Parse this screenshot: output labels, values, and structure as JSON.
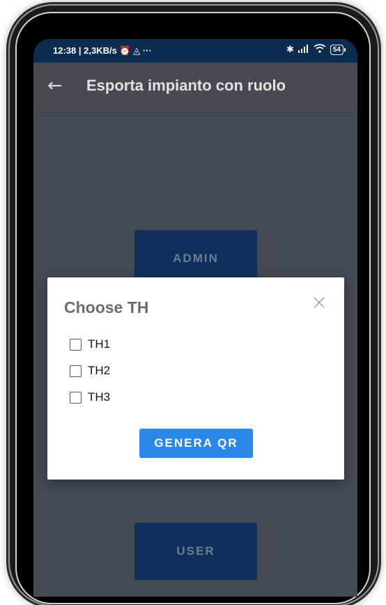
{
  "status_bar": {
    "left_text": "12:38 | 2,3KB/s ⏰ ◬ ···",
    "bluetooth_icon": "bluetooth-icon",
    "signal_icon": "signal-icon",
    "wifi_icon": "wifi-icon",
    "battery_level": "54"
  },
  "app_bar": {
    "back_icon": "back-arrow-icon",
    "title": "Esporta impianto con ruolo"
  },
  "roles": {
    "admin_label": "ADMIN",
    "user_label": "USER"
  },
  "dialog": {
    "title": "Choose TH",
    "close_icon": "close-icon",
    "options": [
      {
        "label": "TH1",
        "checked": false
      },
      {
        "label": "TH2",
        "checked": false
      },
      {
        "label": "TH3",
        "checked": false
      }
    ],
    "generate_label": "GENERA QR"
  },
  "colors": {
    "status_bar_bg": "#0e2c52",
    "screen_dimmed_bg": "#444a52",
    "role_button_bg": "#10305b",
    "primary_button": "#2d87e8"
  }
}
